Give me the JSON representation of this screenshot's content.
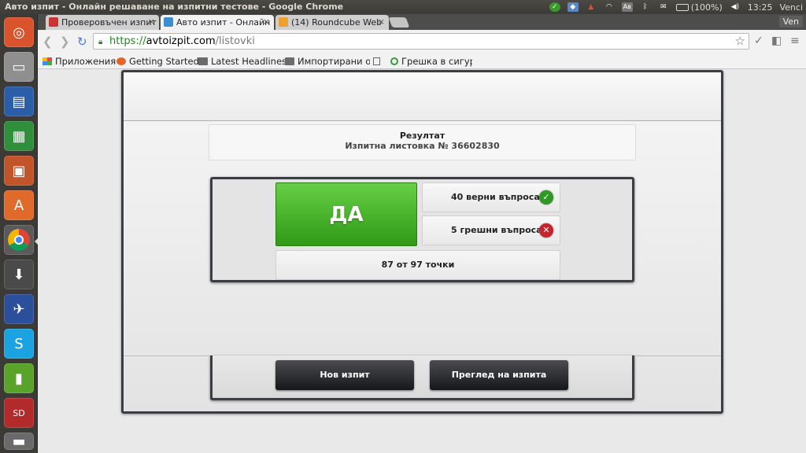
{
  "window": {
    "title": "Авто изпит - Онлайн решаване на изпитни тестове - Google Chrome"
  },
  "tray": {
    "battery": "(100%)",
    "clock": "13:25",
    "user": "Venci",
    "keyboard": "Ав"
  },
  "tabs": [
    {
      "title": "Проверовъчен изпит",
      "active": false
    },
    {
      "title": "Авто изпит - Онлайн",
      "active": true
    },
    {
      "title": "(14) Roundcube Web",
      "active": false
    }
  ],
  "profile": {
    "name": "Ven"
  },
  "address": {
    "scheme": "https://",
    "host": "avtoizpit.com",
    "path": "/listovki"
  },
  "bookmarks": [
    {
      "label": "Приложения",
      "icon": "apps-grid-icon"
    },
    {
      "label": "Getting Started",
      "icon": "firefox-icon"
    },
    {
      "label": "Latest Headlines",
      "icon": "folder-icon"
    },
    {
      "label": "Импортирани от",
      "icon": "folder-icon"
    },
    {
      "label": "",
      "icon": "page-icon"
    },
    {
      "label": "Грешка в сигурн",
      "icon": "refresh-icon"
    }
  ],
  "result": {
    "title": "Резултат",
    "subtitle": "Изпитна листовка № 36602830",
    "verdict": "ДА",
    "correct": "40 верни въпроса",
    "wrong": "5 грешни въпроса",
    "points": "87 от 97 точки"
  },
  "actions": {
    "new_exam": "Нов изпит",
    "review_exam": "Преглед на изпита"
  },
  "colors": {
    "verdict_green": "#3faa22",
    "correct_badge": "#2f9a23",
    "wrong_badge": "#c8232b"
  }
}
